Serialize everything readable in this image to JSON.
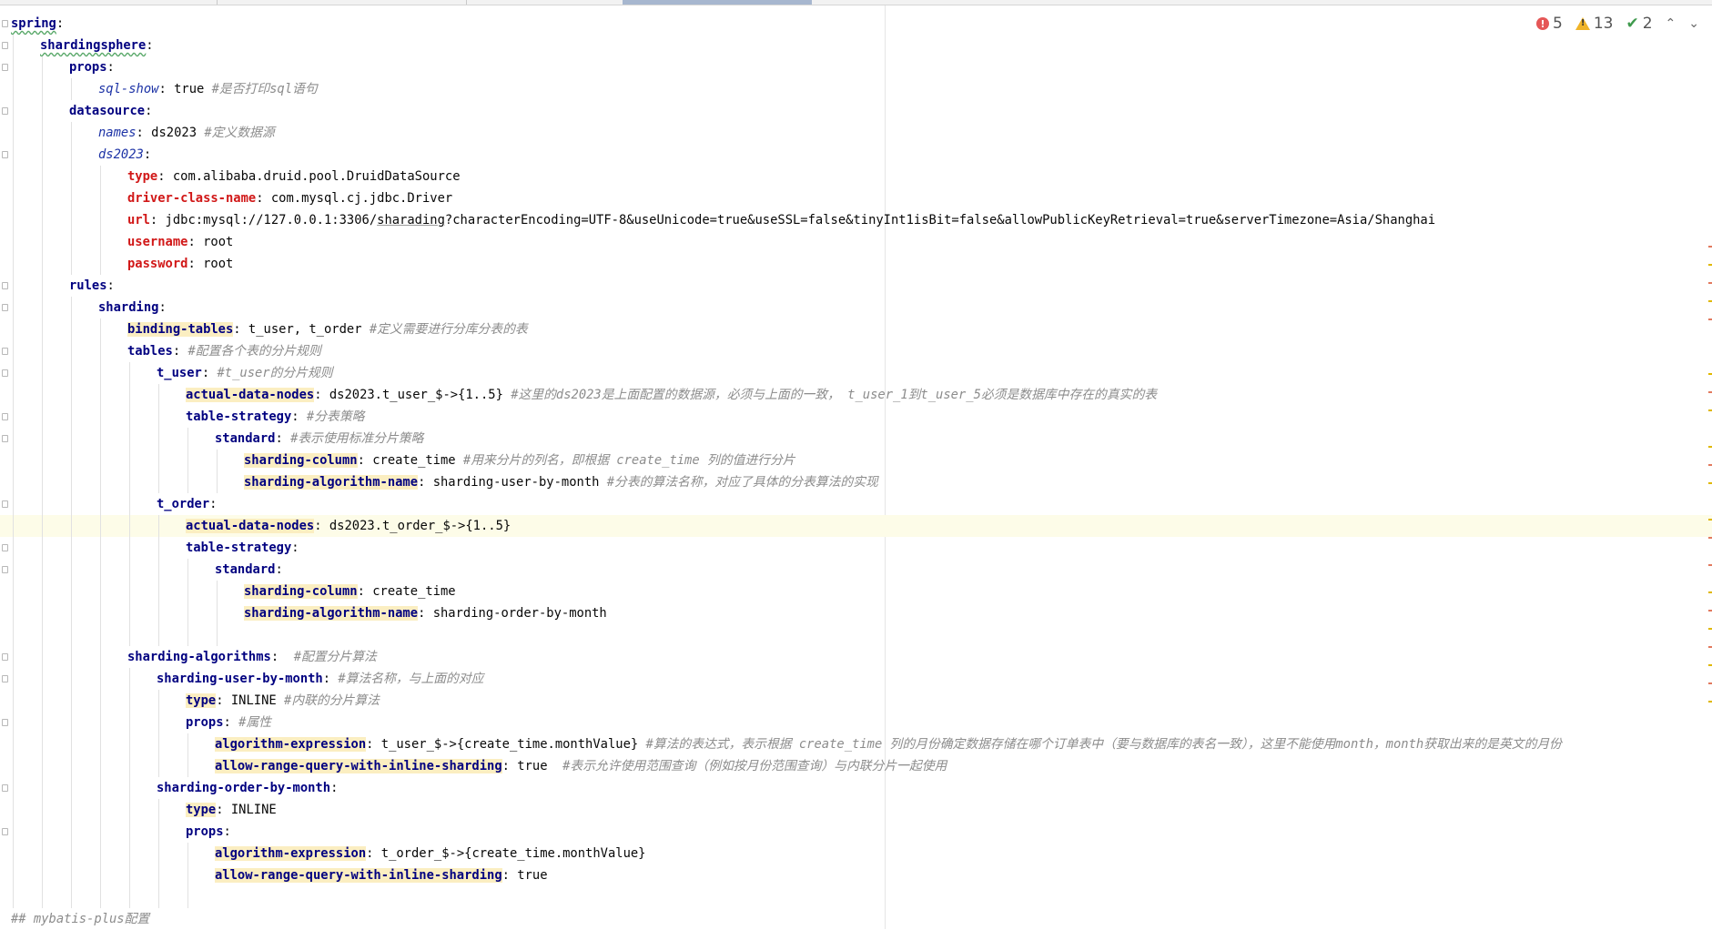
{
  "inspection": {
    "errors": "5",
    "warnings": "13",
    "ok": "2",
    "up": "^",
    "down": "v"
  },
  "lines": [
    {
      "i": 0,
      "parts": [
        {
          "c": "key squig",
          "t": "spring"
        },
        {
          "c": "punc",
          "t": ":"
        }
      ]
    },
    {
      "i": 1,
      "parts": [
        {
          "c": "key squig",
          "t": "shardingsphere"
        },
        {
          "c": "punc",
          "t": ":"
        }
      ]
    },
    {
      "i": 2,
      "parts": [
        {
          "c": "key",
          "t": "props"
        },
        {
          "c": "punc",
          "t": ":"
        }
      ]
    },
    {
      "i": 3,
      "parts": [
        {
          "c": "key ital",
          "t": "sql-show"
        },
        {
          "c": "punc",
          "t": ": "
        },
        {
          "c": "val",
          "t": "true "
        },
        {
          "c": "cmt",
          "t": "#是否打印sql语句"
        }
      ]
    },
    {
      "i": 2,
      "parts": [
        {
          "c": "key",
          "t": "datasource"
        },
        {
          "c": "punc",
          "t": ":"
        }
      ]
    },
    {
      "i": 3,
      "parts": [
        {
          "c": "key ital",
          "t": "names"
        },
        {
          "c": "punc",
          "t": ": "
        },
        {
          "c": "val",
          "t": "ds2023 "
        },
        {
          "c": "cmt",
          "t": "#定义数据源"
        }
      ]
    },
    {
      "i": 3,
      "parts": [
        {
          "c": "key ital",
          "t": "ds2023"
        },
        {
          "c": "punc",
          "t": ":"
        }
      ]
    },
    {
      "i": 4,
      "parts": [
        {
          "c": "key red",
          "t": "type"
        },
        {
          "c": "punc",
          "t": ": "
        },
        {
          "c": "val",
          "t": "com.alibaba.druid.pool.DruidDataSource"
        }
      ]
    },
    {
      "i": 4,
      "parts": [
        {
          "c": "key red",
          "t": "driver-class-name"
        },
        {
          "c": "punc",
          "t": ": "
        },
        {
          "c": "val",
          "t": "com.mysql.cj.jdbc.Driver"
        }
      ]
    },
    {
      "i": 4,
      "parts": [
        {
          "c": "key red",
          "t": "url"
        },
        {
          "c": "punc",
          "t": ": "
        },
        {
          "c": "val",
          "t": "jdbc:mysql://127.0.0.1:3306/"
        },
        {
          "c": "val squig-gray",
          "t": "sharading"
        },
        {
          "c": "val",
          "t": "?characterEncoding=UTF-8&useUnicode=true&useSSL=false&tinyInt1isBit=false&allowPublicKeyRetrieval=true&serverTimezone=Asia/Shanghai"
        }
      ]
    },
    {
      "i": 4,
      "parts": [
        {
          "c": "key red",
          "t": "username"
        },
        {
          "c": "punc",
          "t": ": "
        },
        {
          "c": "val",
          "t": "root"
        }
      ]
    },
    {
      "i": 4,
      "parts": [
        {
          "c": "key red",
          "t": "password"
        },
        {
          "c": "punc",
          "t": ": "
        },
        {
          "c": "val",
          "t": "root"
        }
      ]
    },
    {
      "i": 2,
      "parts": [
        {
          "c": "key",
          "t": "rules"
        },
        {
          "c": "punc",
          "t": ":"
        }
      ]
    },
    {
      "i": 3,
      "parts": [
        {
          "c": "key",
          "t": "sharding"
        },
        {
          "c": "punc",
          "t": ":"
        }
      ]
    },
    {
      "i": 4,
      "parts": [
        {
          "c": "key hl",
          "t": "binding-tables"
        },
        {
          "c": "punc",
          "t": ": "
        },
        {
          "c": "val",
          "t": "t_user, t_order "
        },
        {
          "c": "cmt",
          "t": "#定义需要进行分库分表的表"
        }
      ]
    },
    {
      "i": 4,
      "parts": [
        {
          "c": "key",
          "t": "tables"
        },
        {
          "c": "punc",
          "t": ": "
        },
        {
          "c": "cmt",
          "t": "#配置各个表的分片规则"
        }
      ]
    },
    {
      "i": 5,
      "parts": [
        {
          "c": "key",
          "t": "t_user"
        },
        {
          "c": "punc",
          "t": ": "
        },
        {
          "c": "cmt",
          "t": "#t_user的分片规则"
        }
      ]
    },
    {
      "i": 6,
      "parts": [
        {
          "c": "key hl",
          "t": "actual-data-nodes"
        },
        {
          "c": "punc",
          "t": ": "
        },
        {
          "c": "val",
          "t": "ds2023.t_user_$->{1..5} "
        },
        {
          "c": "cmt",
          "t": "#这里的ds2023是上面配置的数据源，必须与上面的一致， t_user_1到t_user_5必须是数据库中存在的真实的表"
        }
      ]
    },
    {
      "i": 6,
      "parts": [
        {
          "c": "key",
          "t": "table-strategy"
        },
        {
          "c": "punc",
          "t": ": "
        },
        {
          "c": "cmt",
          "t": "#分表策略"
        }
      ]
    },
    {
      "i": 7,
      "parts": [
        {
          "c": "key",
          "t": "standard"
        },
        {
          "c": "punc",
          "t": ": "
        },
        {
          "c": "cmt",
          "t": "#表示使用标准分片策略"
        }
      ]
    },
    {
      "i": 8,
      "parts": [
        {
          "c": "key hl",
          "t": "sharding-column"
        },
        {
          "c": "punc",
          "t": ": "
        },
        {
          "c": "val",
          "t": "create_time "
        },
        {
          "c": "cmt",
          "t": "#用来分片的列名，即根据 create_time 列的值进行分片"
        }
      ]
    },
    {
      "i": 8,
      "parts": [
        {
          "c": "key hl",
          "t": "sharding-algorithm-name"
        },
        {
          "c": "punc",
          "t": ": "
        },
        {
          "c": "val",
          "t": "sharding-user-by-month "
        },
        {
          "c": "cmt",
          "t": "#分表的算法名称，对应了具体的分表算法的实现"
        }
      ]
    },
    {
      "i": 5,
      "parts": [
        {
          "c": "key",
          "t": "t_order"
        },
        {
          "c": "punc",
          "t": ":"
        }
      ]
    },
    {
      "i": 6,
      "current": true,
      "parts": [
        {
          "c": "key hl",
          "t": "actual-data-nodes"
        },
        {
          "c": "punc",
          "t": ": "
        },
        {
          "c": "val",
          "t": "ds2023.t_order_$->{1..5}"
        }
      ]
    },
    {
      "i": 6,
      "parts": [
        {
          "c": "key",
          "t": "table-strategy"
        },
        {
          "c": "punc",
          "t": ":"
        }
      ]
    },
    {
      "i": 7,
      "parts": [
        {
          "c": "key",
          "t": "standard"
        },
        {
          "c": "punc",
          "t": ":"
        }
      ]
    },
    {
      "i": 8,
      "parts": [
        {
          "c": "key hl",
          "t": "sharding-column"
        },
        {
          "c": "punc",
          "t": ": "
        },
        {
          "c": "val",
          "t": "create_time"
        }
      ]
    },
    {
      "i": 8,
      "parts": [
        {
          "c": "key hl",
          "t": "sharding-algorithm-name"
        },
        {
          "c": "punc",
          "t": ": "
        },
        {
          "c": "val",
          "t": "sharding-order-by-month"
        }
      ]
    },
    {
      "i": 0,
      "parts": []
    },
    {
      "i": 4,
      "parts": [
        {
          "c": "key",
          "t": "sharding-algorithms"
        },
        {
          "c": "punc",
          "t": ":  "
        },
        {
          "c": "cmt",
          "t": "#配置分片算法"
        }
      ]
    },
    {
      "i": 5,
      "parts": [
        {
          "c": "key",
          "t": "sharding-user-by-month"
        },
        {
          "c": "punc",
          "t": ": "
        },
        {
          "c": "cmt",
          "t": "#算法名称，与上面的对应"
        }
      ]
    },
    {
      "i": 6,
      "parts": [
        {
          "c": "key hl",
          "t": "type"
        },
        {
          "c": "punc",
          "t": ": "
        },
        {
          "c": "val",
          "t": "INLINE "
        },
        {
          "c": "cmt",
          "t": "#内联的分片算法"
        }
      ]
    },
    {
      "i": 6,
      "parts": [
        {
          "c": "key",
          "t": "props"
        },
        {
          "c": "punc",
          "t": ": "
        },
        {
          "c": "cmt",
          "t": "#属性"
        }
      ]
    },
    {
      "i": 7,
      "parts": [
        {
          "c": "key hl",
          "t": "algorithm-expression"
        },
        {
          "c": "punc",
          "t": ": "
        },
        {
          "c": "val",
          "t": "t_user_$->{create_time.monthValue} "
        },
        {
          "c": "cmt",
          "t": "#算法的表达式，表示根据 create_time 列的月份确定数据存储在哪个订单表中（要与数据库的表名一致），这里不能使用month，month获取出来的是英文的月份"
        }
      ]
    },
    {
      "i": 7,
      "parts": [
        {
          "c": "key hl",
          "t": "allow-range-query-with-inline-sharding"
        },
        {
          "c": "punc",
          "t": ": "
        },
        {
          "c": "val",
          "t": "true  "
        },
        {
          "c": "cmt",
          "t": "#表示允许使用范围查询（例如按月份范围查询）与内联分片一起使用"
        }
      ]
    },
    {
      "i": 5,
      "parts": [
        {
          "c": "key",
          "t": "sharding-order-by-month"
        },
        {
          "c": "punc",
          "t": ":"
        }
      ]
    },
    {
      "i": 6,
      "parts": [
        {
          "c": "key hl",
          "t": "type"
        },
        {
          "c": "punc",
          "t": ": "
        },
        {
          "c": "val",
          "t": "INLINE"
        }
      ]
    },
    {
      "i": 6,
      "parts": [
        {
          "c": "key",
          "t": "props"
        },
        {
          "c": "punc",
          "t": ":"
        }
      ]
    },
    {
      "i": 7,
      "parts": [
        {
          "c": "key hl",
          "t": "algorithm-expression"
        },
        {
          "c": "punc",
          "t": ": "
        },
        {
          "c": "val",
          "t": "t_order_$->{create_time.monthValue}"
        }
      ]
    },
    {
      "i": 7,
      "parts": [
        {
          "c": "key hl",
          "t": "allow-range-query-with-inline-sharding"
        },
        {
          "c": "punc",
          "t": ": "
        },
        {
          "c": "val",
          "t": "true"
        }
      ]
    },
    {
      "i": 0,
      "parts": []
    },
    {
      "i": 0,
      "parts": [
        {
          "c": "cmt",
          "t": "## mybatis-plus配置"
        }
      ]
    }
  ]
}
